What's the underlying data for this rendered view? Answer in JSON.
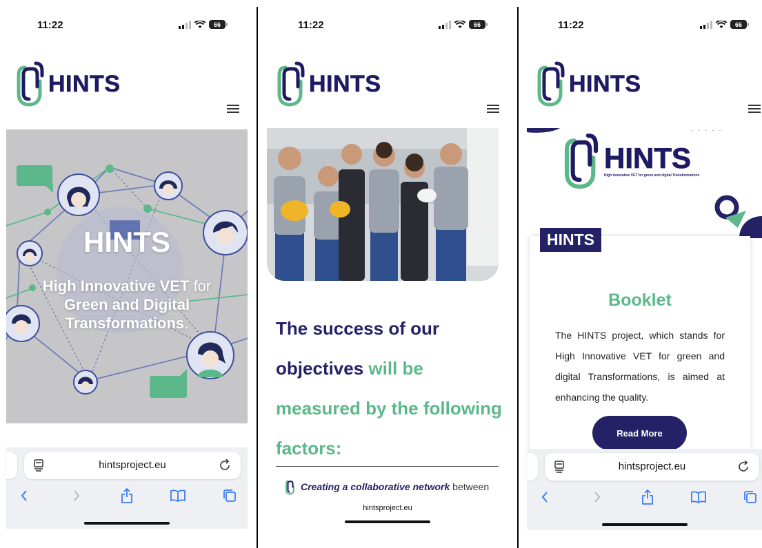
{
  "status": {
    "time": "11:22",
    "battery": "66"
  },
  "brand": {
    "name": "HINTS",
    "tagline": "High Innovative VET for green and digital Transformations"
  },
  "panel1": {
    "hero_title": "HINTS",
    "hero_sub_bold1": "High Innovative VET",
    "hero_sub_thin1": " for",
    "hero_sub_bold2": "Green and Digital Transformations",
    "hero_sub_thin2": "."
  },
  "panel2": {
    "heading_dark": "The success of our objectives",
    "heading_green": " will be measured by the following factors:",
    "factor_bold": "Creating a collaborative network",
    "factor_rest": " between",
    "compact_url": "hintsproject.eu"
  },
  "panel3": {
    "label": "HINTS",
    "card_title": "Booklet",
    "card_text": "The HINTS project, which stands for High Innovative VET for green and digital Transformations, is aimed at enhancing the quality.",
    "button": "Read More",
    "dots": "· · · · ·"
  },
  "safari": {
    "url": "hintsproject.eu"
  },
  "colors": {
    "navy": "#242166",
    "green": "#5cb88a",
    "hero_bg": "#c6c6c8"
  }
}
